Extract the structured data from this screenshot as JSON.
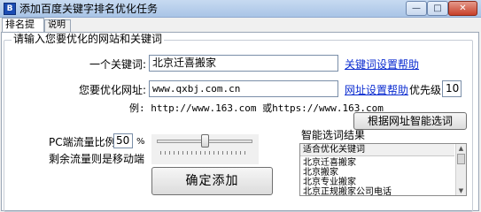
{
  "window": {
    "title": "添加百度关键字排名优化任务",
    "icon": "app-logo-icon",
    "icon_glyph": "B",
    "controls": {
      "minimize": "—",
      "maximize": "□",
      "close": "✕"
    }
  },
  "tabs": [
    {
      "label": "排名提升任务",
      "active": true
    },
    {
      "label": "说明",
      "active": false
    }
  ],
  "group": {
    "caption": "请输入您要优化的网站和关键词"
  },
  "form": {
    "keyword_label": "一个关键词:",
    "keyword_value": "北京迁喜搬家",
    "keyword_help_link": "关键词设置帮助",
    "url_label": "您要优化网址:",
    "url_value": "www.qxbj.com.cn",
    "url_help_link": "网址设置帮助",
    "priority_label": "优先级",
    "priority_value": "10",
    "example_text": "例: http://www.163.com 或https://www.163.com",
    "smart_select_button": "根据网址智能选词",
    "pc_ratio_label": "PC端流量比例",
    "pc_ratio_value": "50",
    "pc_ratio_unit": "%",
    "slider_level_percent": 50,
    "remaining_text": "剩余流量则是移动端",
    "confirm_button": "确定添加"
  },
  "smart_results": {
    "caption": "智能选词结果",
    "column_header": "适合优化关键词",
    "rows": [
      "北京迁喜搬家",
      "北京搬家",
      "北京专业搬家",
      "北京正规搬家公司电话"
    ]
  }
}
